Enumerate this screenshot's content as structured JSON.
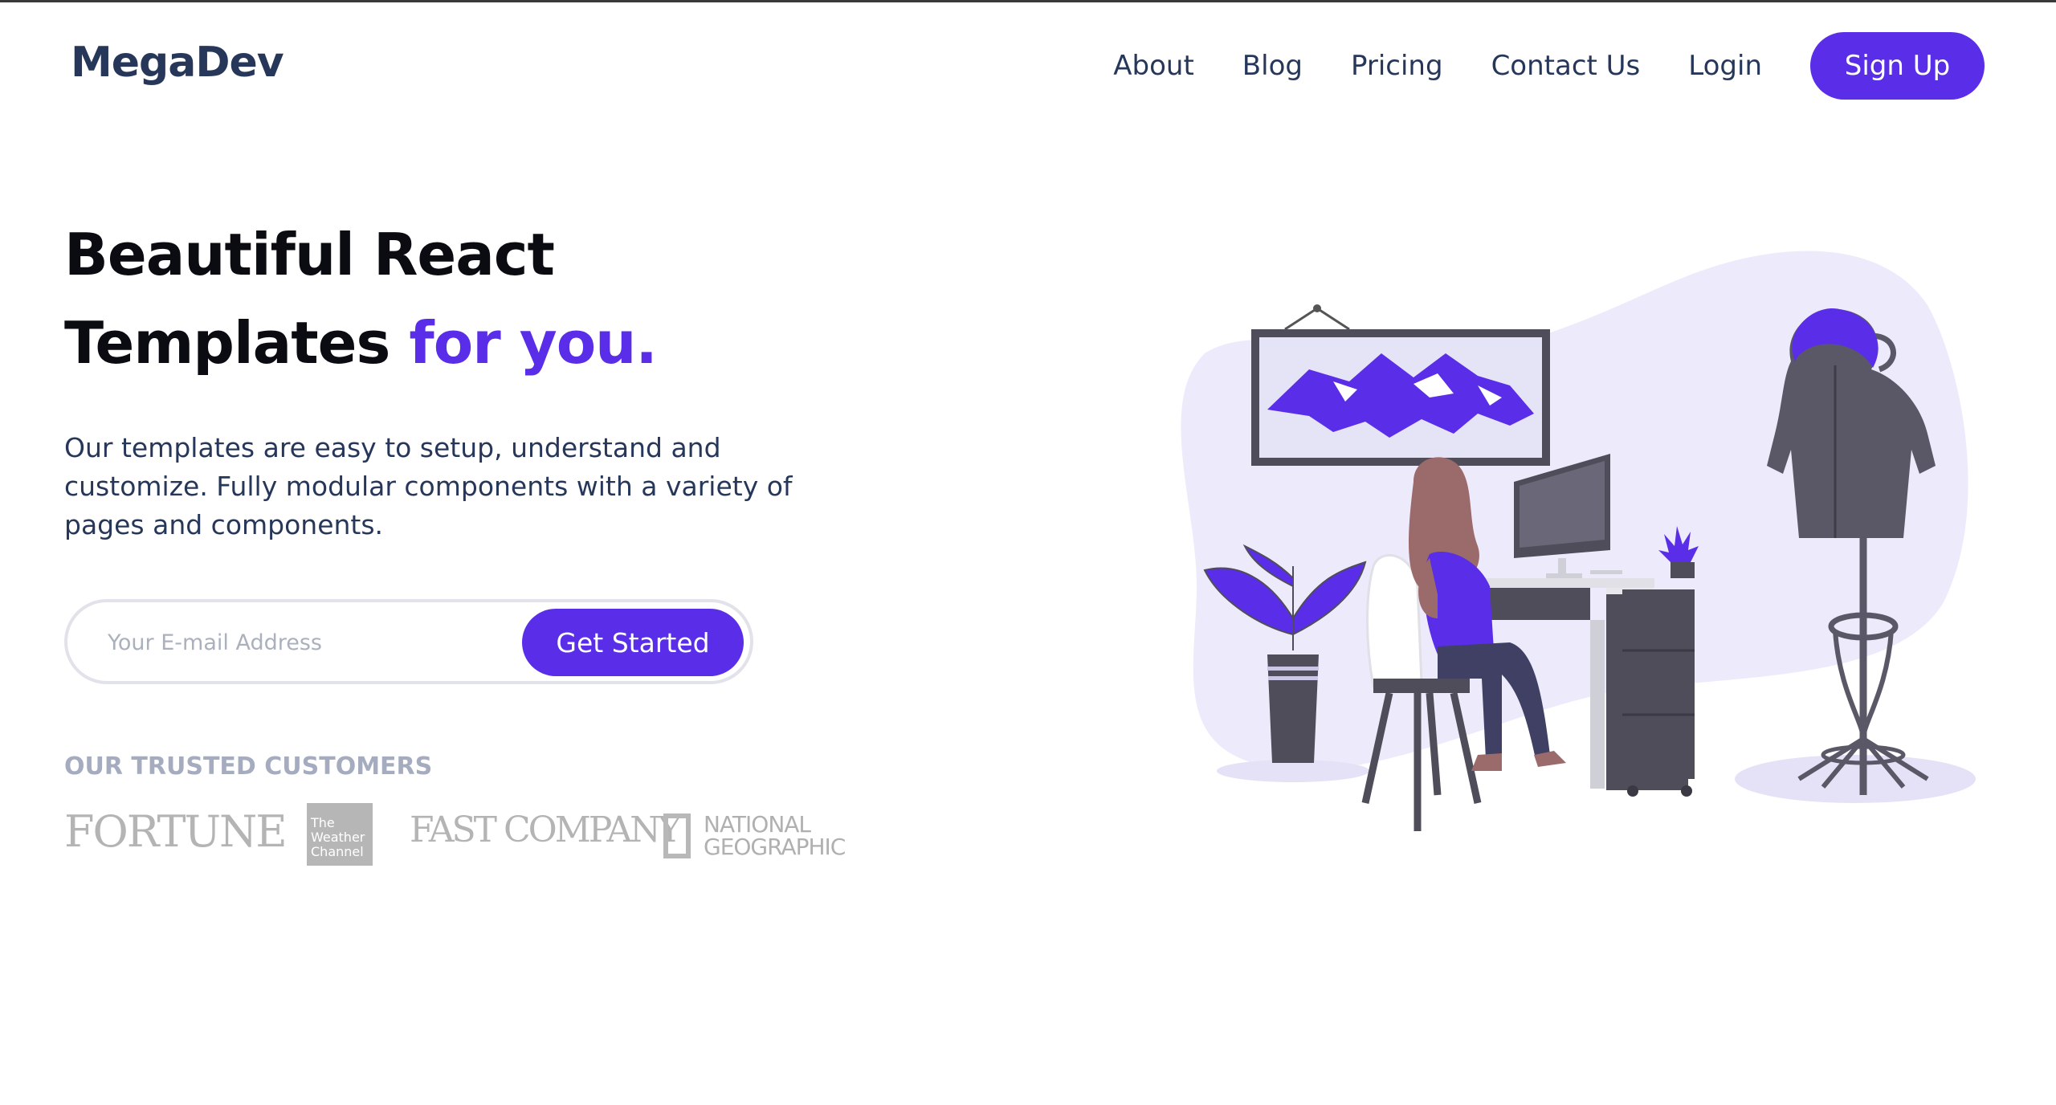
{
  "brand": {
    "logo": "MegaDev"
  },
  "nav": {
    "links": [
      "About",
      "Blog",
      "Pricing",
      "Contact Us",
      "Login"
    ],
    "signup_label": "Sign Up"
  },
  "hero": {
    "title_line1": "Beautiful React",
    "title_line2": "Templates",
    "title_accent": "for you.",
    "description": "Our templates are easy to setup, understand and customize. Fully modular components with a variety of pages and components."
  },
  "signup_form": {
    "email_placeholder": "Your E-mail Address",
    "email_value": "",
    "cta_label": "Get Started"
  },
  "customers": {
    "heading": "OUR TRUSTED CUSTOMERS",
    "logos": {
      "fortune": "FORTUNE",
      "weather_channel": [
        "The",
        "Weather",
        "Channel"
      ],
      "fast_company": "FAST COMPANY",
      "national_geographic": [
        "NATIONAL",
        "GEOGRAPHIC"
      ]
    }
  },
  "colors": {
    "accent": "#5a2de8",
    "navy": "#26375a",
    "muted": "#a5acbf",
    "blob": "#edeafc"
  }
}
